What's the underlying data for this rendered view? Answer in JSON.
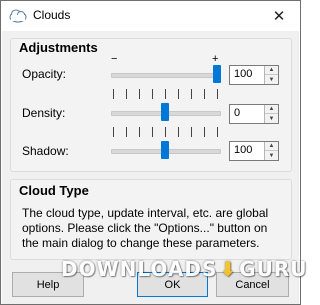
{
  "window": {
    "title": "Clouds",
    "close_glyph": "✕"
  },
  "adjustments": {
    "title": "Adjustments",
    "min_label": "−",
    "max_label": "+",
    "opacity": {
      "label": "Opacity:",
      "value": "100",
      "level": 1.0
    },
    "density": {
      "label": "Density:",
      "value": "0",
      "level": 0.5
    },
    "shadow": {
      "label": "Shadow:",
      "value": "100",
      "level": 0.5
    }
  },
  "cloud_type": {
    "title": "Cloud Type",
    "text": "The cloud type, update interval, etc. are global options. Please click the \"Options...\" button on the main dialog to change these parameters."
  },
  "buttons": {
    "help": "Help",
    "ok": "OK",
    "cancel": "Cancel"
  },
  "watermark": {
    "left": "DOWNLOADS",
    "right": "GURU"
  },
  "colors": {
    "accent": "#0078d7",
    "watermark_arrow": "#f5c21b"
  }
}
